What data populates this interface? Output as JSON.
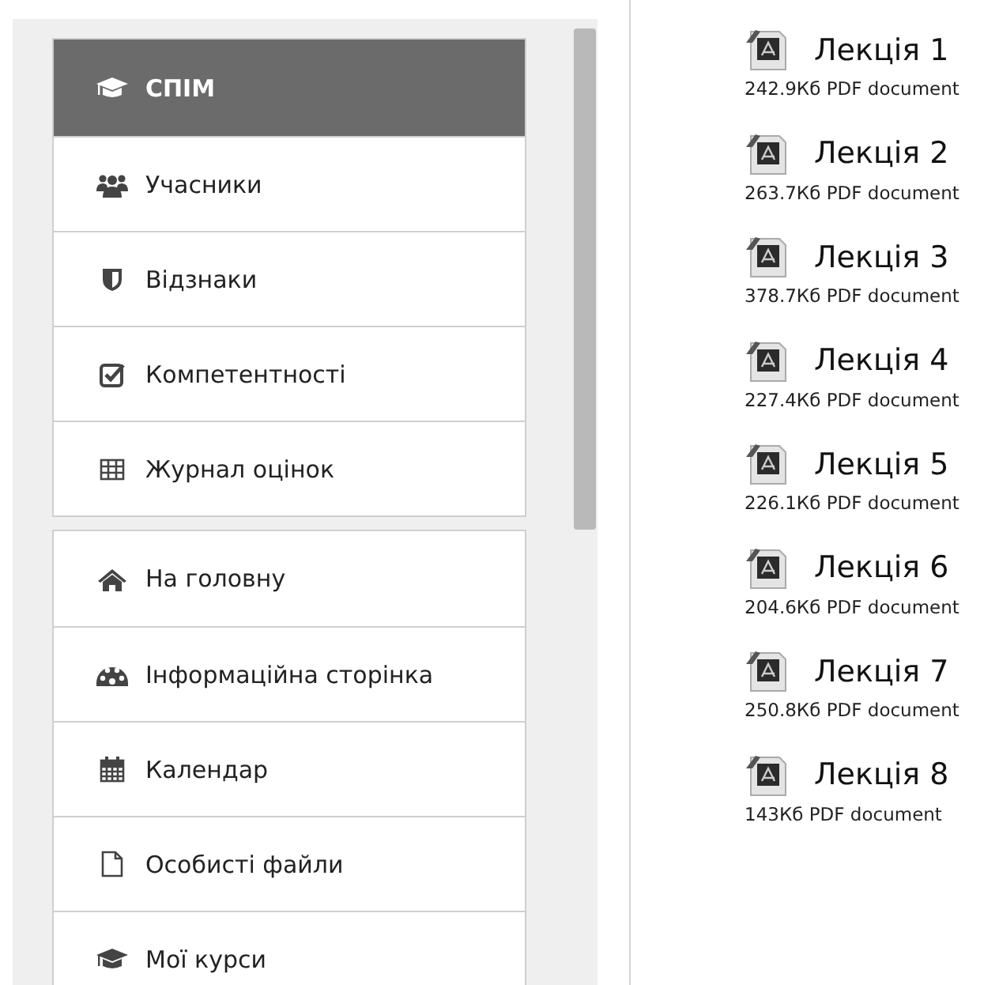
{
  "nav_groups": [
    {
      "items": [
        {
          "label": "СПІМ",
          "selected": true
        },
        {
          "label": "Учасники",
          "selected": false
        },
        {
          "label": "Відзнаки",
          "selected": false
        },
        {
          "label": "Компетентності",
          "selected": false
        },
        {
          "label": "Журнал оцінок",
          "selected": false
        }
      ]
    },
    {
      "items": [
        {
          "label": "На головну",
          "selected": false
        },
        {
          "label": "Інформаційна сторінка",
          "selected": false
        },
        {
          "label": "Календар",
          "selected": false
        },
        {
          "label": "Особисті файли",
          "selected": false
        },
        {
          "label": "Мої курси",
          "selected": false
        }
      ]
    }
  ],
  "files": [
    {
      "title": "Лекція 1",
      "info": "242.9Кб PDF document"
    },
    {
      "title": "Лекція 2",
      "info": "263.7Кб PDF document"
    },
    {
      "title": "Лекція 3",
      "info": "378.7Кб PDF document"
    },
    {
      "title": "Лекція 4",
      "info": "227.4Кб PDF document"
    },
    {
      "title": "Лекція 5",
      "info": "226.1Кб PDF document"
    },
    {
      "title": "Лекція 6",
      "info": "204.6Кб PDF document"
    },
    {
      "title": "Лекція 7",
      "info": "250.8Кб PDF document"
    },
    {
      "title": "Лекція 8",
      "info": "143Кб PDF document"
    }
  ]
}
